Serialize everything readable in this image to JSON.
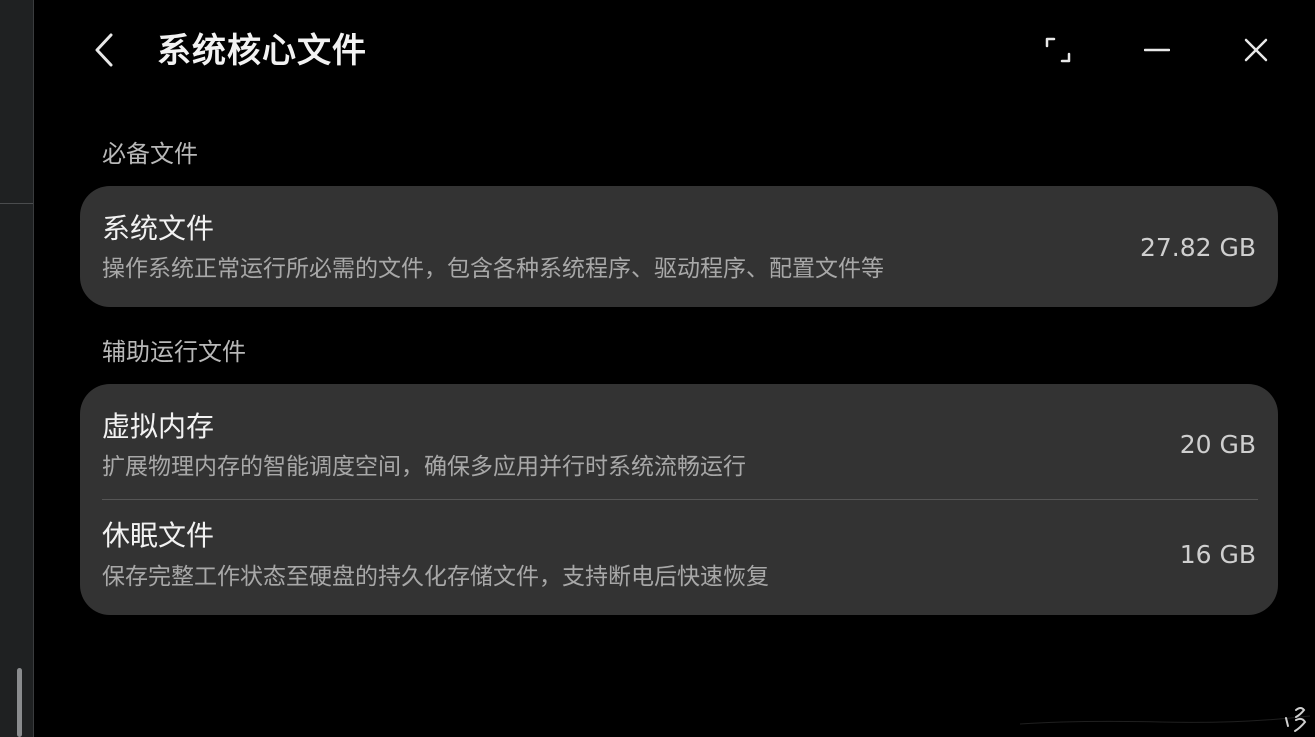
{
  "header": {
    "title": "系统核心文件"
  },
  "icons": {
    "back": "chevron-left-icon",
    "maximize": "maximize-corners-icon",
    "minimize": "minus-icon",
    "close": "close-icon"
  },
  "sections": [
    {
      "label": "必备文件",
      "items": [
        {
          "title": "系统文件",
          "description": "操作系统正常运行所必需的文件，包含各种系统程序、驱动程序、配置文件等",
          "size": "27.82 GB"
        }
      ]
    },
    {
      "label": "辅助运行文件",
      "items": [
        {
          "title": "虚拟内存",
          "description": "扩展物理内存的智能调度空间，确保多应用并行时系统流畅运行",
          "size": "20 GB"
        },
        {
          "title": "休眠文件",
          "description": "保存完整工作状态至硬盘的持久化存储文件，支持断电后快速恢复",
          "size": "16 GB"
        }
      ]
    }
  ],
  "colors": {
    "background": "#000000",
    "card": "#333333",
    "title_text": "#f2f2f2",
    "secondary_text": "#a8a8a8"
  }
}
